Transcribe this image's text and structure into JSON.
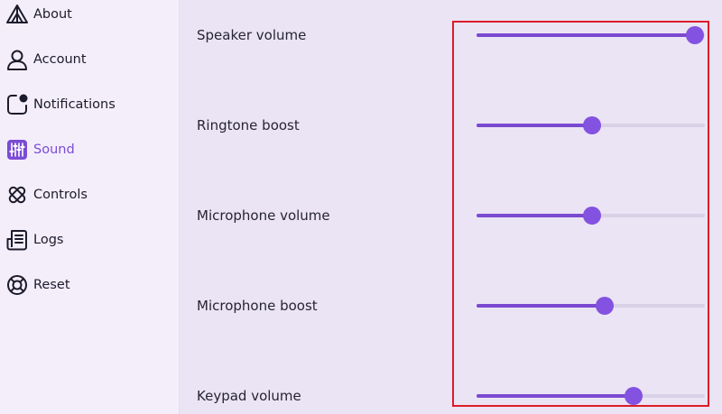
{
  "sidebar": {
    "items": [
      {
        "id": "about",
        "label": "About",
        "icon": "about-icon",
        "active": false
      },
      {
        "id": "account",
        "label": "Account",
        "icon": "user-icon",
        "active": false
      },
      {
        "id": "notifications",
        "label": "Notifications",
        "icon": "notification-icon",
        "active": false
      },
      {
        "id": "sound",
        "label": "Sound",
        "icon": "sliders-icon",
        "active": true
      },
      {
        "id": "controls",
        "label": "Controls",
        "icon": "controls-icon",
        "active": false
      },
      {
        "id": "logs",
        "label": "Logs",
        "icon": "document-icon",
        "active": false
      },
      {
        "id": "reset",
        "label": "Reset",
        "icon": "lifebuoy-icon",
        "active": false
      }
    ]
  },
  "sound": {
    "settings": [
      {
        "id": "speaker-volume",
        "label": "Speaker volume",
        "value": 1.0
      },
      {
        "id": "ringtone-boost",
        "label": "Ringtone boost",
        "value": 0.5
      },
      {
        "id": "microphone-volume",
        "label": "Microphone volume",
        "value": 0.5
      },
      {
        "id": "microphone-boost",
        "label": "Microphone boost",
        "value": 0.56
      },
      {
        "id": "keypad-volume",
        "label": "Keypad volume",
        "value": 0.7
      }
    ]
  },
  "colors": {
    "accent": "#7b4cd4",
    "thumb": "#8352e0",
    "track": "#d9d1e6",
    "highlight": "#dd1c28"
  }
}
